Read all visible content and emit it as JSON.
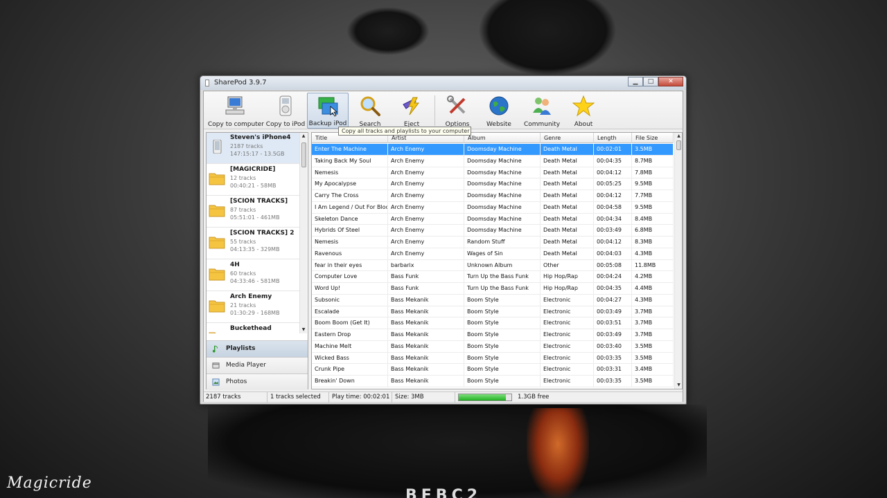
{
  "window": {
    "title": "SharePod 3.9.7"
  },
  "toolbar": {
    "buttons": [
      {
        "label": "Copy to computer",
        "icon": "computer-icon"
      },
      {
        "label": "Copy to iPod",
        "icon": "ipod-icon"
      },
      {
        "label": "Backup iPod",
        "icon": "backup-icon"
      },
      {
        "label": "Search",
        "icon": "magnifier-icon"
      },
      {
        "label": "Eject",
        "icon": "eject-icon"
      },
      {
        "label": "Options",
        "icon": "tools-icon"
      },
      {
        "label": "Website",
        "icon": "globe-icon"
      },
      {
        "label": "Community",
        "icon": "people-icon"
      },
      {
        "label": "About",
        "icon": "star-icon"
      }
    ],
    "tooltip": "Copy all tracks and playlists to your computer"
  },
  "sidebar": {
    "devices": [
      {
        "name": "Steven's iPhone4",
        "line2": "2187 tracks",
        "line3": "147:15:17 - 13.5GB",
        "type": "device"
      },
      {
        "name": "[MAGICRIDE]",
        "line2": "12 tracks",
        "line3": "00:40:21 - 58MB",
        "type": "folder"
      },
      {
        "name": "[SCION TRACKS]",
        "line2": "87 tracks",
        "line3": "05:51:01 - 461MB",
        "type": "folder"
      },
      {
        "name": "[SCION TRACKS] 2",
        "line2": "55 tracks",
        "line3": "04:13:35 - 329MB",
        "type": "folder"
      },
      {
        "name": "4H",
        "line2": "60 tracks",
        "line3": "04:33:46 - 581MB",
        "type": "folder"
      },
      {
        "name": "Arch Enemy",
        "line2": "21 tracks",
        "line3": "01:30:29 - 168MB",
        "type": "folder"
      },
      {
        "name": "Buckethead",
        "line2": "",
        "line3": "",
        "type": "folder"
      }
    ],
    "sections": [
      {
        "label": "Playlists",
        "icon": "playlist-icon"
      },
      {
        "label": "Media Player",
        "icon": "media-player-icon"
      },
      {
        "label": "Photos",
        "icon": "photos-icon"
      }
    ]
  },
  "table": {
    "columns": [
      "Title",
      "Artist",
      "Album",
      "Genre",
      "Length",
      "File Size"
    ],
    "rows": [
      [
        "Enter The Machine",
        "Arch Enemy",
        "Doomsday Machine",
        "Death Metal",
        "00:02:01",
        "3.5MB"
      ],
      [
        "Taking Back My Soul",
        "Arch Enemy",
        "Doomsday Machine",
        "Death Metal",
        "00:04:35",
        "8.7MB"
      ],
      [
        "Nemesis",
        "Arch Enemy",
        "Doomsday Machine",
        "Death Metal",
        "00:04:12",
        "7.8MB"
      ],
      [
        "My Apocalypse",
        "Arch Enemy",
        "Doomsday Machine",
        "Death Metal",
        "00:05:25",
        "9.5MB"
      ],
      [
        "Carry The Cross",
        "Arch Enemy",
        "Doomsday Machine",
        "Death Metal",
        "00:04:12",
        "7.7MB"
      ],
      [
        "I Am Legend / Out For Blood",
        "Arch Enemy",
        "Doomsday Machine",
        "Death Metal",
        "00:04:58",
        "9.5MB"
      ],
      [
        "Skeleton Dance",
        "Arch Enemy",
        "Doomsday Machine",
        "Death Metal",
        "00:04:34",
        "8.4MB"
      ],
      [
        "Hybrids Of Steel",
        "Arch Enemy",
        "Doomsday Machine",
        "Death Metal",
        "00:03:49",
        "6.8MB"
      ],
      [
        "Nemesis",
        "Arch Enemy",
        "Random Stuff",
        "Death Metal",
        "00:04:12",
        "8.3MB"
      ],
      [
        "Ravenous",
        "Arch Enemy",
        "Wages of Sin",
        "Death Metal",
        "00:04:03",
        "4.3MB"
      ],
      [
        "fear in their eyes",
        "barbarix",
        "Unknown Album",
        "Other",
        "00:05:08",
        "11.8MB"
      ],
      [
        "Computer Love",
        "Bass Funk",
        "Turn Up the Bass Funk",
        "Hip Hop/Rap",
        "00:04:24",
        "4.2MB"
      ],
      [
        "Word Up!",
        "Bass Funk",
        "Turn Up the Bass Funk",
        "Hip Hop/Rap",
        "00:04:35",
        "4.4MB"
      ],
      [
        "Subsonic",
        "Bass Mekanik",
        "Boom Style",
        "Electronic",
        "00:04:27",
        "4.3MB"
      ],
      [
        "Escalade",
        "Bass Mekanik",
        "Boom Style",
        "Electronic",
        "00:03:49",
        "3.7MB"
      ],
      [
        "Boom Boom (Get It)",
        "Bass Mekanik",
        "Boom Style",
        "Electronic",
        "00:03:51",
        "3.7MB"
      ],
      [
        "Eastern Drop",
        "Bass Mekanik",
        "Boom Style",
        "Electronic",
        "00:03:49",
        "3.7MB"
      ],
      [
        "Machine Melt",
        "Bass Mekanik",
        "Boom Style",
        "Electronic",
        "00:03:40",
        "3.5MB"
      ],
      [
        "Wicked Bass",
        "Bass Mekanik",
        "Boom Style",
        "Electronic",
        "00:03:35",
        "3.5MB"
      ],
      [
        "Crunk Pipe",
        "Bass Mekanik",
        "Boom Style",
        "Electronic",
        "00:03:31",
        "3.4MB"
      ],
      [
        "Breakin' Down",
        "Bass Mekanik",
        "Boom Style",
        "Electronic",
        "00:03:35",
        "3.5MB"
      ]
    ]
  },
  "status": {
    "tracks": "2187 tracks",
    "selected": "1 tracks selected",
    "playtime": "Play time: 00:02:01",
    "size": "Size: 3MB",
    "free": "1.3GB free",
    "usage_fraction": 0.9
  },
  "desktop": {
    "watermark": "Magicride",
    "logo": "BFBC2"
  }
}
